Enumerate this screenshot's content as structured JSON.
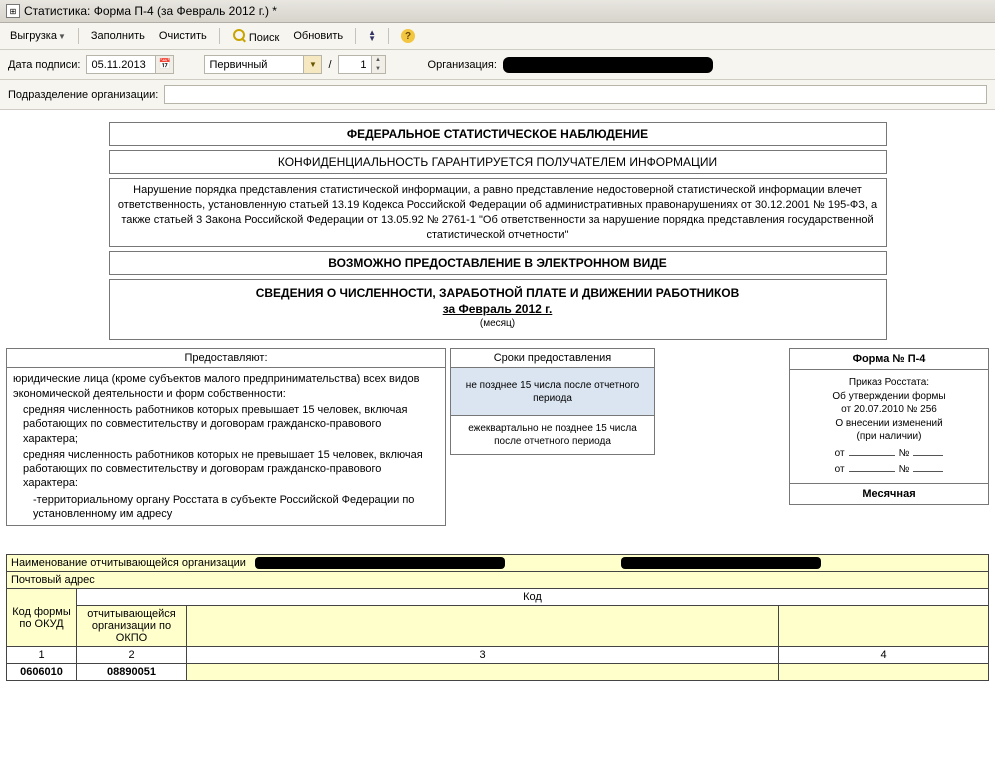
{
  "window": {
    "title": "Статистика: Форма П-4 (за Февраль 2012 г.) *"
  },
  "toolbar": {
    "unload": "Выгрузка",
    "fill": "Заполнить",
    "clear": "Очистить",
    "search": "Поиск",
    "update": "Обновить"
  },
  "params": {
    "date_label": "Дата подписи:",
    "date_value": "05.11.2013",
    "type_value": "Первичный",
    "slash": "/",
    "num_value": "1",
    "org_label": "Организация:",
    "subdiv_label": "Подразделение организации:"
  },
  "headers": {
    "h1": "ФЕДЕРАЛЬНОЕ СТАТИСТИЧЕСКОЕ НАБЛЮДЕНИЕ",
    "h2": "КОНФИДЕНЦИАЛЬНОСТЬ ГАРАНТИРУЕТСЯ ПОЛУЧАТЕЛЕМ ИНФОРМАЦИИ",
    "h3": "Нарушение порядка представления статистической информации, а равно представление недостоверной статистической информации влечет ответственность, установленную статьей 13.19 Кодекса Российской Федерации об административных правонарушениях от 30.12.2001 № 195-ФЗ, а также статьей 3 Закона Российской Федерации от 13.05.92 № 2761-1 \"Об ответственности за нарушение порядка представления государственной статистической отчетности\"",
    "h4": "ВОЗМОЖНО ПРЕДОСТАВЛЕНИЕ В ЭЛЕКТРОННОМ ВИДЕ",
    "h5_main": "СВЕДЕНИЯ О ЧИСЛЕННОСТИ, ЗАРАБОТНОЙ ПЛАТЕ И ДВИЖЕНИИ РАБОТНИКОВ",
    "h5_period": "за Февраль 2012 г.",
    "h5_sub": "(месяц)"
  },
  "providers": {
    "col1_header": "Предоставляют:",
    "col2_header": "Сроки предоставления",
    "col1_line1": "юридические лица (кроме субъектов малого предпринимательства) всех видов экономической деятельности и форм собственности:",
    "col1_line2": "средняя численность работников которых превышает 15 человек, включая работающих по совместительству и договорам гражданско-правового характера;",
    "col1_line3": "средняя численность работников которых не превышает 15 человек, включая работающих по совместительству и договорам гражданско-правового характера:",
    "col1_line4": "-территориальному органу Росстата в субъекте Российской Федерации по установленному им адресу",
    "col2_cell1": "не позднее 15 числа после отчетного периода",
    "col2_cell2": "ежеквартально не позднее 15 числа после отчетного периода"
  },
  "formbox": {
    "title": "Форма № П-4",
    "line1": "Приказ Росстата:",
    "line2": "Об утверждении формы",
    "line3": "от 20.07.2010 № 256",
    "line4": "О внесении изменений",
    "line5": "(при наличии)",
    "ot": "от",
    "no": "№",
    "period": "Месячная"
  },
  "bottom": {
    "org_name_label": "Наименование отчитывающейся организации",
    "postal_label": "Почтовый адрес",
    "code_header": "Код",
    "okud_label": "Код формы по ОКУД",
    "okpo_label": "отчитывающейся организации по ОКПО",
    "c1": "1",
    "c2": "2",
    "c3": "3",
    "c4": "4",
    "okud_val": "0606010",
    "okpo_val": "08890051"
  }
}
